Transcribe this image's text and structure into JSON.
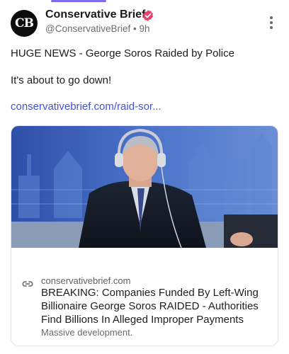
{
  "post": {
    "author": {
      "avatar_text": "CB",
      "name": "Conservative Brief",
      "handle": "@ConservativeBrief",
      "separator": "•",
      "time": "9h",
      "verified_icon": "verified-badge-icon",
      "verified_color": "#e8416b"
    },
    "text_line1": "HUGE NEWS - George Soros Raided by Police",
    "text_line2": "It's about to go down!",
    "link": "conservativebrief.com/raid-sor...",
    "link_color": "#4453d6",
    "accent_color": "#7b6cf0"
  },
  "link_card": {
    "image_alt": "photo-elderly-man-with-headphones",
    "domain": "conservativebrief.com",
    "title": "BREAKING: Companies Funded By Left-Wing Billionaire George Soros RAIDED - Authorities Find Billions In Alleged Improper Payments",
    "description": "Massive development."
  }
}
